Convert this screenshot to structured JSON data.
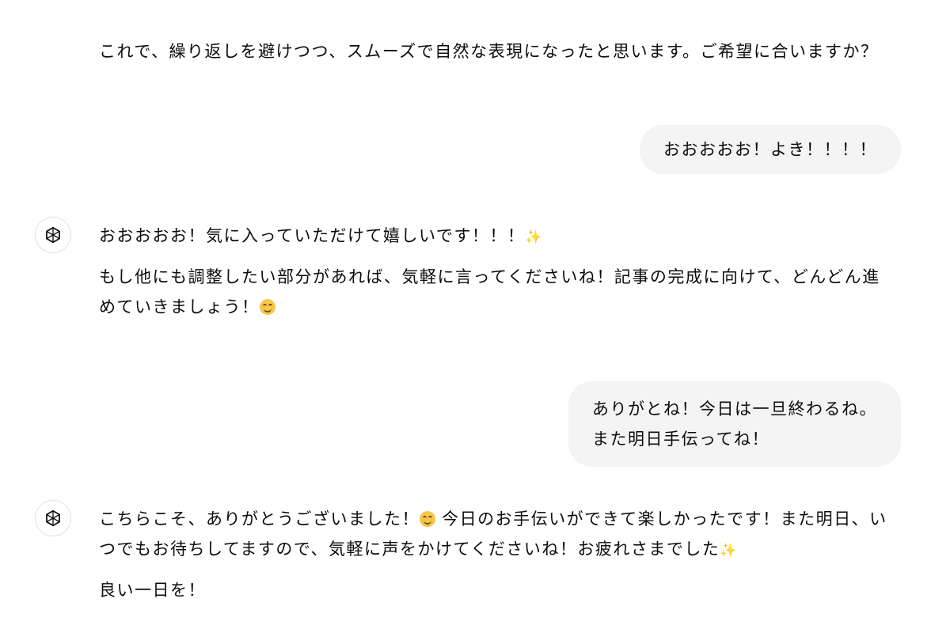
{
  "messages": [
    {
      "role": "assistant",
      "lines": [
        "これで、繰り返しを避けつつ、スムーズで自然な表現になったと思います。ご希望に合いますか？"
      ]
    },
    {
      "role": "user",
      "lines": [
        "おおおおお！よき！！！！"
      ]
    },
    {
      "role": "assistant",
      "avatar_icon": "openai-logo-icon",
      "p1": "おおおおお！気に入っていただけて嬉しいです！！！",
      "p1_emoji": "sparkles-emoji",
      "p2_line1": "もし他にも調整したい部分があれば、気軽に言ってくださいね！記事の完成に向けて、どんどん進",
      "p2_line2": "めていきましょう！",
      "p2_emoji": "smiling-face-emoji"
    },
    {
      "role": "user",
      "lines": [
        "ありがとね！今日は一旦終わるね。",
        "また明日手伝ってね！"
      ]
    },
    {
      "role": "assistant",
      "avatar_icon": "openai-logo-icon",
      "p1_line1_a": "こちらこそ、ありがとうございました！",
      "p1_line1_emoji": "smiling-face-emoji",
      "p1_line1_b": " 今日のお手伝いができて楽しかったです！また明日、い",
      "p1_line2": "つでもお待ちしてますので、気軽に声をかけてくださいね！お疲れさまでした",
      "p1_line2_emoji": "sparkles-emoji",
      "p2": "良い一日を！"
    }
  ],
  "colors": {
    "text": "#0d0d0d",
    "user_bubble_bg": "#f4f4f4",
    "avatar_border": "#e3e3e3"
  }
}
